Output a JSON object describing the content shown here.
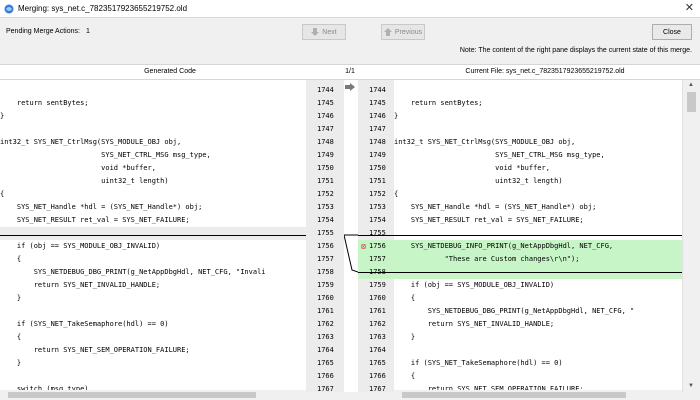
{
  "window": {
    "title": "Merging: sys_net.c_7823517923655219752.old"
  },
  "toolbar": {
    "pending_label": "Pending Merge Actions:",
    "pending_count": "1",
    "next_label": "Next",
    "previous_label": "Previous",
    "close_label": "Close"
  },
  "note": "Note:  The content of the right pane displays the current state of this merge.",
  "headers": {
    "left": "Generated Code",
    "middle": "1/1",
    "right": "Current File: sys_net.c_7823517923655219752.old"
  },
  "colors": {
    "added_bg": "#c8f5c8",
    "gutter_bg": "#ececec",
    "marker": "#d04040"
  },
  "left_pane": {
    "lines": [
      {
        "num": "1744",
        "text": ""
      },
      {
        "num": "1745",
        "text": "    return sentBytes;"
      },
      {
        "num": "1746",
        "text": "}"
      },
      {
        "num": "1747",
        "text": ""
      },
      {
        "num": "1748",
        "text": "int32_t SYS_NET_CtrlMsg(SYS_MODULE_OBJ obj,"
      },
      {
        "num": "1749",
        "text": "                        SYS_NET_CTRL_MSG msg_type,"
      },
      {
        "num": "1750",
        "text": "                        void *buffer,"
      },
      {
        "num": "1751",
        "text": "                        uint32_t length)"
      },
      {
        "num": "1752",
        "text": "{"
      },
      {
        "num": "1753",
        "text": "    SYS_NET_Handle *hdl = (SYS_NET_Handle*) obj;"
      },
      {
        "num": "1754",
        "text": "    SYS_NET_RESULT ret_val = SYS_NET_FAILURE;"
      },
      {
        "num": "1755",
        "text": ""
      },
      {
        "num": "1756",
        "text": "    if (obj == SYS_MODULE_OBJ_INVALID)"
      },
      {
        "num": "1757",
        "text": "    {"
      },
      {
        "num": "1758",
        "text": "        SYS_NETDEBUG_DBG_PRINT(g_NetAppDbgHdl, NET_CFG, \"Invali"
      },
      {
        "num": "1759",
        "text": "        return SYS_NET_INVALID_HANDLE;"
      },
      {
        "num": "1760",
        "text": "    }"
      },
      {
        "num": "1761",
        "text": ""
      },
      {
        "num": "1762",
        "text": "    if (SYS_NET_TakeSemaphore(hdl) == 0)"
      },
      {
        "num": "1763",
        "text": "    {"
      },
      {
        "num": "1764",
        "text": "        return SYS_NET_SEM_OPERATION_FAILURE;"
      },
      {
        "num": "1765",
        "text": "    }"
      },
      {
        "num": "1766",
        "text": ""
      },
      {
        "num": "1767",
        "text": "    switch (msg_type)"
      }
    ]
  },
  "right_pane": {
    "lines": [
      {
        "num": "1744",
        "text": ""
      },
      {
        "num": "1745",
        "text": "    return sentBytes;"
      },
      {
        "num": "1746",
        "text": "}"
      },
      {
        "num": "1747",
        "text": ""
      },
      {
        "num": "1748",
        "text": "int32_t SYS_NET_CtrlMsg(SYS_MODULE_OBJ obj,"
      },
      {
        "num": "1749",
        "text": "                        SYS_NET_CTRL_MSG msg_type,"
      },
      {
        "num": "1750",
        "text": "                        void *buffer,"
      },
      {
        "num": "1751",
        "text": "                        uint32_t length)"
      },
      {
        "num": "1752",
        "text": "{"
      },
      {
        "num": "1753",
        "text": "    SYS_NET_Handle *hdl = (SYS_NET_Handle*) obj;"
      },
      {
        "num": "1754",
        "text": "    SYS_NET_RESULT ret_val = SYS_NET_FAILURE;"
      },
      {
        "num": "1755",
        "text": ""
      },
      {
        "num": "1756",
        "text": "    SYS_NETDEBUG_INFO_PRINT(g_NetAppDbgHdl, NET_CFG,"
      },
      {
        "num": "1757",
        "text": "            \"These are Custom changes\\r\\n\");"
      },
      {
        "num": "1758",
        "text": ""
      },
      {
        "num": "1759",
        "text": "    if (obj == SYS_MODULE_OBJ_INVALID)"
      },
      {
        "num": "1760",
        "text": "    {"
      },
      {
        "num": "1761",
        "text": "        SYS_NETDEBUG_DBG_PRINT(g_NetAppDbgHdl, NET_CFG, \""
      },
      {
        "num": "1762",
        "text": "        return SYS_NET_INVALID_HANDLE;"
      },
      {
        "num": "1763",
        "text": "    }"
      },
      {
        "num": "1764",
        "text": ""
      },
      {
        "num": "1765",
        "text": "    if (SYS_NET_TakeSemaphore(hdl) == 0)"
      },
      {
        "num": "1766",
        "text": "    {"
      },
      {
        "num": "1767",
        "text": "        return SYS_NET_SEM_OPERATION_FAILURE;"
      }
    ]
  }
}
